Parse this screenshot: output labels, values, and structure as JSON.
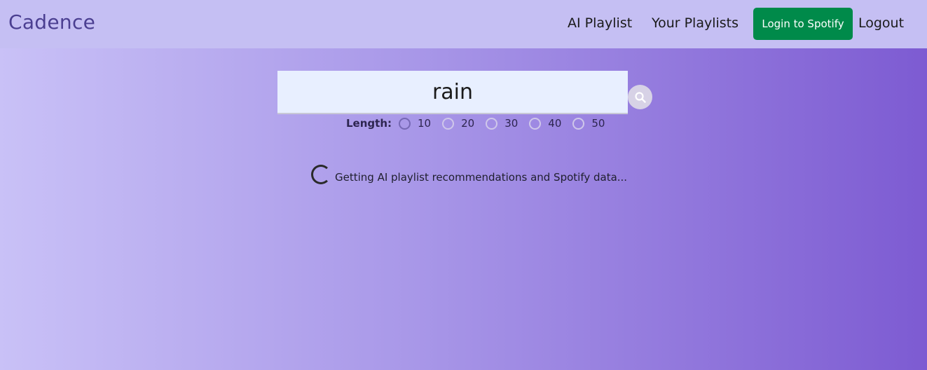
{
  "nav": {
    "brand": "Cadence",
    "ai_playlist": "AI Playlist",
    "your_playlists": "Your Playlists",
    "login": "Login to Spotify",
    "logout": "Logout"
  },
  "search": {
    "value": "rain",
    "icon": "search-icon"
  },
  "length": {
    "label": "Length:",
    "options": [
      "10",
      "20",
      "30",
      "40",
      "50"
    ]
  },
  "loading": {
    "text": "Getting AI playlist recommendations and Spotify data..."
  },
  "colors": {
    "login_button": "#008a4a",
    "brand": "#4b3f91"
  }
}
